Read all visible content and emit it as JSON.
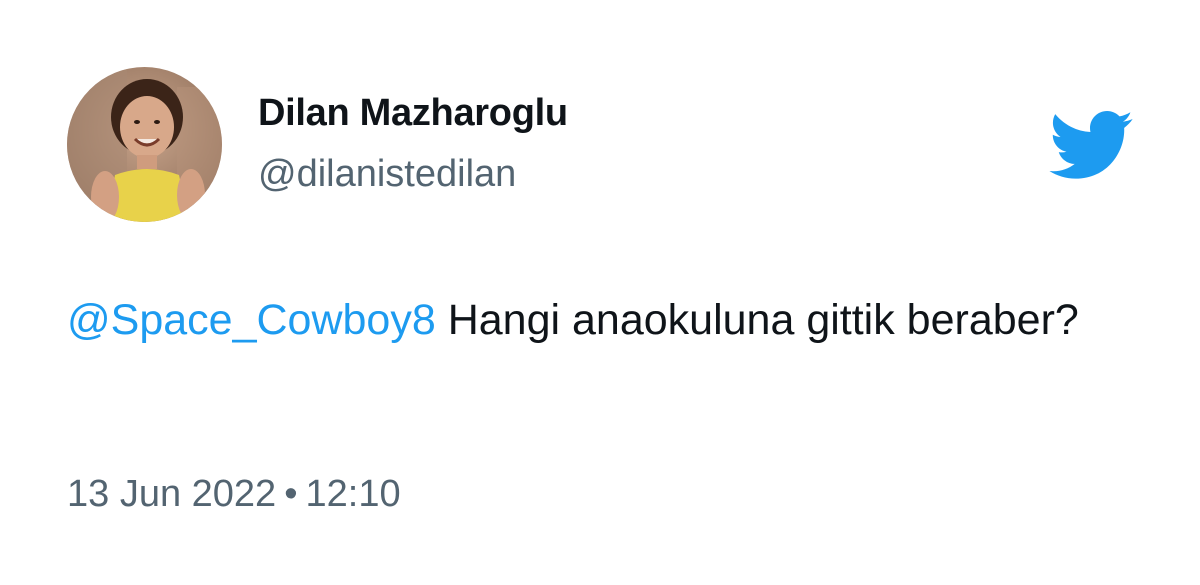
{
  "tweet": {
    "author": {
      "display_name": "Dilan Mazharoglu",
      "handle": "@dilanistedilan",
      "avatar_icon": "profile-photo"
    },
    "body": {
      "mention": "@Space_Cowboy8",
      "text": " Hangi anaokuluna gittik beraber?"
    },
    "date": "13 Jun 2022",
    "separator": "•",
    "time": "12:10"
  },
  "brand": {
    "icon": "twitter-bird-icon",
    "color": "#1d9bf0"
  },
  "colors": {
    "text": "#0f1419",
    "secondary": "#536471",
    "link": "#1d9bf0"
  }
}
